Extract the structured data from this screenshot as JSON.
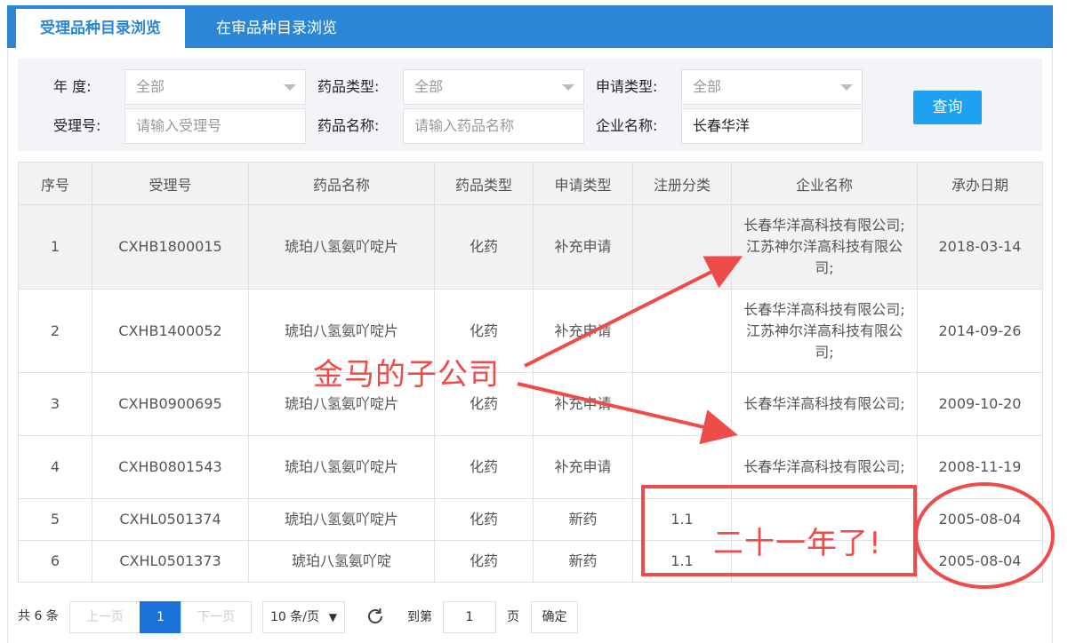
{
  "tabs": [
    {
      "label": "受理品种目录浏览",
      "active": true
    },
    {
      "label": "在审品种目录浏览",
      "active": false
    }
  ],
  "filters": {
    "year_label": "年   度:",
    "year_value": "全部",
    "drug_type_label": "药品类型:",
    "drug_type_value": "全部",
    "apply_type_label": "申请类型:",
    "apply_type_value": "全部",
    "accept_no_label": "受理号:",
    "accept_no_placeholder": "请输入受理号",
    "drug_name_label": "药品名称:",
    "drug_name_placeholder": "请输入药品名称",
    "company_label": "企业名称:",
    "company_value": "长春华洋",
    "query_button": "查询"
  },
  "table": {
    "headers": [
      "序号",
      "受理号",
      "药品名称",
      "药品类型",
      "申请类型",
      "注册分类",
      "企业名称",
      "承办日期"
    ],
    "rows": [
      {
        "no": "1",
        "accept_no": "CXHB1800015",
        "drug": "琥珀八氢氨吖啶片",
        "type": "化药",
        "apply": "补充申请",
        "reg": "",
        "company": "长春华洋高科技有限公司;江苏神尔洋高科技有限公司;",
        "date": "2018-03-14"
      },
      {
        "no": "2",
        "accept_no": "CXHB1400052",
        "drug": "琥珀八氢氨吖啶片",
        "type": "化药",
        "apply": "补充申请",
        "reg": "",
        "company": "长春华洋高科技有限公司;江苏神尔洋高科技有限公司;",
        "date": "2014-09-26"
      },
      {
        "no": "3",
        "accept_no": "CXHB0900695",
        "drug": "琥珀八氢氨吖啶片",
        "type": "化药",
        "apply": "补充申请",
        "reg": "",
        "company": "长春华洋高科技有限公司;",
        "date": "2009-10-20"
      },
      {
        "no": "4",
        "accept_no": "CXHB0801543",
        "drug": "琥珀八氢氨吖啶片",
        "type": "化药",
        "apply": "补充申请",
        "reg": "",
        "company": "长春华洋高科技有限公司;",
        "date": "2008-11-19"
      },
      {
        "no": "5",
        "accept_no": "CXHL0501374",
        "drug": "琥珀八氢氨吖啶片",
        "type": "化药",
        "apply": "新药",
        "reg": "1.1",
        "company": "",
        "date": "2005-08-04"
      },
      {
        "no": "6",
        "accept_no": "CXHL0501373",
        "drug": "琥珀八氢氨吖啶",
        "type": "化药",
        "apply": "新药",
        "reg": "1.1",
        "company": "",
        "date": "2005-08-04"
      }
    ]
  },
  "pagination": {
    "total": "共 6 条",
    "prev": "上一页",
    "current_page": "1",
    "next": "下一页",
    "page_size": "10 条/页",
    "goto_label": "到第",
    "goto_value": "1",
    "page_unit": "页",
    "confirm": "确定"
  },
  "annotations": {
    "subsidiary": "金马的子公司",
    "years": "二十一年了!",
    "color": "#ee4b4b"
  },
  "colors": {
    "tab_bar": "#2c86d6",
    "query_button": "#1ea1f0",
    "current_page": "#1a73d8"
  }
}
